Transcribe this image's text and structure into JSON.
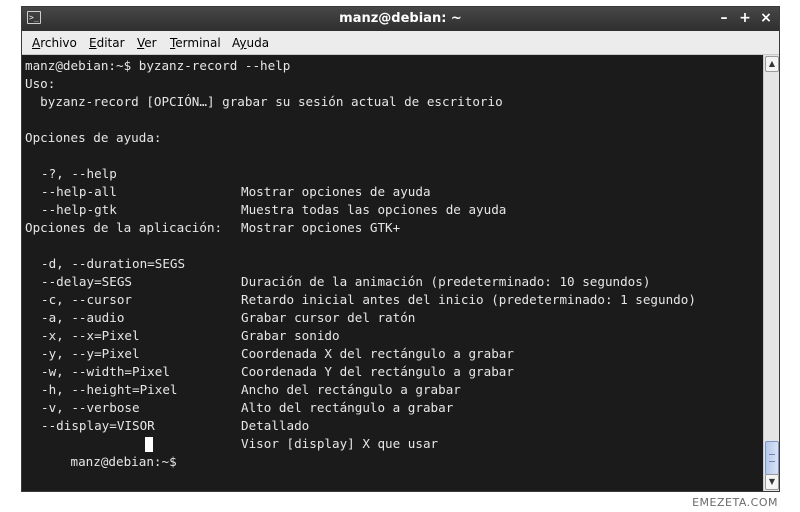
{
  "window": {
    "title": "manz@debian: ~",
    "controls": {
      "minimize": "–",
      "maximize": "+",
      "close": "×"
    }
  },
  "menubar": {
    "items": [
      {
        "label": "Archivo",
        "mnemonic": "A",
        "rest": "rchivo"
      },
      {
        "label": "Editar",
        "mnemonic": "E",
        "rest": "ditar"
      },
      {
        "label": "Ver",
        "mnemonic": "V",
        "rest": "er"
      },
      {
        "label": "Terminal",
        "mnemonic": "T",
        "rest": "erminal"
      },
      {
        "label": "Ayuda",
        "mnemonic": "y",
        "rest_before": "A",
        "rest_after": "uda"
      }
    ]
  },
  "terminal": {
    "command_line": "manz@debian:~$ byzanz-record --help",
    "usage_header": "Uso:",
    "usage_line": "  byzanz-record [OPCIÓN…] grabar su sesión actual de escritorio",
    "help_header": "Opciones de ayuda:",
    "help_options": [
      {
        "flag": "-?, --help",
        "desc": "Mostrar opciones de ayuda"
      },
      {
        "flag": "--help-all",
        "desc": "Muestra todas las opciones de ayuda"
      },
      {
        "flag": "--help-gtk",
        "desc": "Mostrar opciones GTK+"
      }
    ],
    "app_header": "Opciones de la aplicación:",
    "app_options": [
      {
        "flag": "-d, --duration=SEGS",
        "desc": "Duración de la animación (predeterminado: 10 segundos)"
      },
      {
        "flag": "--delay=SEGS",
        "desc": "Retardo inicial antes del inicio (predeterminado: 1 segundo)"
      },
      {
        "flag": "-c, --cursor",
        "desc": "Grabar cursor del ratón"
      },
      {
        "flag": "-a, --audio",
        "desc": "Grabar sonido"
      },
      {
        "flag": "-x, --x=Pixel",
        "desc": "Coordenada X del rectángulo a grabar"
      },
      {
        "flag": "-y, --y=Pixel",
        "desc": "Coordenada Y del rectángulo a grabar"
      },
      {
        "flag": "-w, --width=Pixel",
        "desc": "Ancho del rectángulo a grabar"
      },
      {
        "flag": "-h, --height=Pixel",
        "desc": "Alto del rectángulo a grabar"
      },
      {
        "flag": "-v, --verbose",
        "desc": "Detallado"
      },
      {
        "flag": "--display=VISOR",
        "desc": "Visor [display] X que usar"
      }
    ],
    "prompt": "manz@debian:~$"
  },
  "watermark": "EMEZETA.COM",
  "colors": {
    "terminal_bg": "#1b1b1b",
    "terminal_fg": "#e6e6e6",
    "titlebar_bg": "#3a3a3a",
    "menubar_bg": "#ececec"
  }
}
